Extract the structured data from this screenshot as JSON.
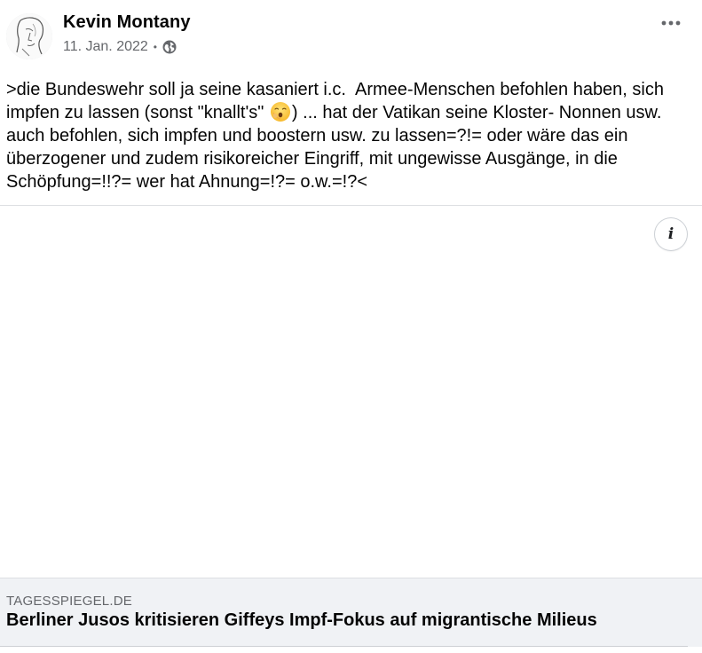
{
  "post": {
    "author_name": "Kevin Montany",
    "date": "11. Jan. 2022",
    "separator": "•",
    "privacy_icon": "globe-icon",
    "more_icon": "more-dots-icon",
    "text_before_emoji": ">die Bundeswehr soll ja seine kasaniert i.c.  Armee-Menschen befohlen haben, sich impfen zu lassen (sonst \"knallt's\" ",
    "emoji": "hushed-face-emoji",
    "text_after_emoji": ") ... hat der Vatikan seine Kloster- Nonnen usw.  auch befohlen, sich impfen und boostern usw. zu lassen=?!= oder wäre das ein überzogener und zudem risikoreicher Eingriff, mit ungewisse Ausgänge, in die Schöpfung=!!?= wer hat Ahnung=!?= o.w.=!?<"
  },
  "media": {
    "info_label": "i",
    "info_icon": "info-icon"
  },
  "link_preview": {
    "domain": "TAGESSPIEGEL.DE",
    "title": "Berliner Jusos kritisieren Giffeys Impf-Fokus auf migrantische Milieus"
  },
  "colors": {
    "text_primary": "#050505",
    "text_secondary": "#65676b",
    "card_background": "#f0f2f5",
    "divider": "#dddfe2"
  }
}
